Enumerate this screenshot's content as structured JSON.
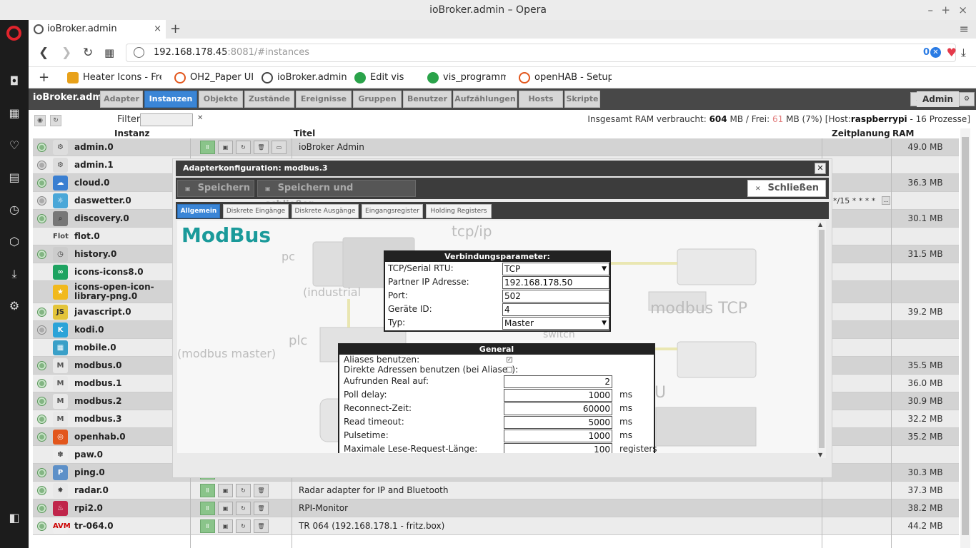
{
  "window": {
    "title": "ioBroker.admin – Opera",
    "minimize": "–",
    "maximize": "+",
    "close": "×"
  },
  "browser": {
    "tab_title": "ioBroker.admin",
    "tab_close": "×",
    "new_tab": "+",
    "tab_menu": "≡",
    "url_host": "192.168.178.45",
    "url_rest": ":8081/#instances",
    "blocker_count": "0",
    "bookmarks": [
      "Heater Icons - Free",
      "OH2_Paper UI",
      "ioBroker.admin",
      "Edit vis",
      "vis_programmierun",
      "openHAB - Setup"
    ],
    "bookmark_add": "+"
  },
  "app": {
    "brand": "ioBroker.admin",
    "nav_tabs": [
      "Adapter",
      "Instanzen",
      "Objekte",
      "Zustände",
      "Ereignisse",
      "Gruppen",
      "Benutzer",
      "Aufzählungen",
      "Hosts",
      "Skripte"
    ],
    "active_tab": "Instanzen",
    "user": "Admin",
    "filter_label": "Filter:",
    "filter_value": "",
    "ram": {
      "prefix": "Insgesamt RAM verbraucht:",
      "used": "604",
      "mid": "MB / Frei:",
      "free": "61",
      "pct": "MB (7%)",
      "host_pre": "[Host:",
      "host": "raspberrypi",
      "host_post": "- 16 Prozesse]"
    },
    "columns": {
      "instanz": "Instanz",
      "titel": "Titel",
      "zeitplanung": "Zeitplanung",
      "ram": "RAM Benutzung"
    },
    "instances": [
      {
        "name": "admin.0",
        "icon": "⚙",
        "running": true,
        "title": "ioBroker Admin",
        "ram": "49.0 MB"
      },
      {
        "name": "admin.1",
        "icon": "⚙",
        "running": false,
        "title": "",
        "ram": ""
      },
      {
        "name": "cloud.0",
        "icon": "☁",
        "running": true,
        "title": "",
        "ram": "36.3 MB"
      },
      {
        "name": "daswetter.0",
        "icon": "☼",
        "running": false,
        "title": "",
        "ram": ""
      },
      {
        "name": "discovery.0",
        "icon": "⌕",
        "running": true,
        "title": "",
        "ram": "30.1 MB"
      },
      {
        "name": "flot.0",
        "icon": "Flot",
        "running": null,
        "title": "",
        "ram": ""
      },
      {
        "name": "history.0",
        "icon": "◷",
        "running": true,
        "title": "",
        "ram": "31.5 MB"
      },
      {
        "name": "icons-icons8.0",
        "icon": "∞",
        "running": null,
        "title": "",
        "ram": ""
      },
      {
        "name": "icons-open-icon-library-png.0",
        "icon": "★",
        "running": null,
        "title": "",
        "ram": ""
      },
      {
        "name": "javascript.0",
        "icon": "JS",
        "running": true,
        "title": "",
        "ram": "39.2 MB"
      },
      {
        "name": "kodi.0",
        "icon": "K",
        "running": false,
        "title": "",
        "ram": ""
      },
      {
        "name": "mobile.0",
        "icon": "▦",
        "running": null,
        "title": "",
        "ram": ""
      },
      {
        "name": "modbus.0",
        "icon": "M",
        "running": true,
        "title": "",
        "ram": "35.5 MB"
      },
      {
        "name": "modbus.1",
        "icon": "M",
        "running": true,
        "title": "",
        "ram": "36.0 MB"
      },
      {
        "name": "modbus.2",
        "icon": "M",
        "running": true,
        "title": "",
        "ram": "30.9 MB"
      },
      {
        "name": "modbus.3",
        "icon": "M",
        "running": true,
        "title": "",
        "ram": "32.2 MB"
      },
      {
        "name": "openhab.0",
        "icon": "◎",
        "running": true,
        "title": "",
        "ram": "35.2 MB"
      },
      {
        "name": "paw.0",
        "icon": "✽",
        "running": null,
        "title": "",
        "ram": ""
      },
      {
        "name": "ping.0",
        "icon": "P",
        "running": true,
        "title": "",
        "ram": "30.3 MB"
      },
      {
        "name": "radar.0",
        "icon": "✸",
        "running": true,
        "title": "Radar adapter for IP and Bluetooth",
        "ram": "37.3 MB"
      },
      {
        "name": "rpi2.0",
        "icon": "♨",
        "running": true,
        "title": "RPI-Monitor",
        "ram": "38.2 MB"
      },
      {
        "name": "tr-064.0",
        "icon": "AVM",
        "running": true,
        "title": "TR 064 (192.168.178.1 - fritz.box)",
        "ram": "44.2 MB"
      }
    ],
    "schedule_text": "*/15 * * * *"
  },
  "dialog": {
    "title": "Adapterkonfiguration: modbus.3",
    "close": "✕",
    "btn_save": "Speichern",
    "btn_save_close": "Speichern und schließen",
    "btn_close": "Schließen",
    "tabs": [
      "Allgemein",
      "Diskrete Eingänge",
      "Diskrete Ausgänge",
      "Eingangsregister",
      "Holding Registers"
    ],
    "active_tab": "Allgemein",
    "heading": "ModBus",
    "bg_labels": [
      "pc",
      "(industrial",
      "tcp/ip",
      "modbus TCP",
      "plc",
      "(modbus master)",
      "switch",
      "U"
    ],
    "conn": {
      "title": "Verbindungsparameter:",
      "fields": [
        {
          "label": "TCP/Serial RTU:",
          "value": "TCP",
          "select": true
        },
        {
          "label": "Partner IP Adresse:",
          "value": "192.168.178.50",
          "select": false
        },
        {
          "label": "Port:",
          "value": "502",
          "select": false
        },
        {
          "label": "Geräte ID:",
          "value": "4",
          "select": false
        },
        {
          "label": "Typ:",
          "value": "Master",
          "select": true
        }
      ]
    },
    "general": {
      "title": "General",
      "checks": [
        {
          "label": "Aliases benutzen:",
          "checked": true
        },
        {
          "label": "Direkte Adressen benutzen (bei Aliases):",
          "checked": false
        }
      ],
      "fields": [
        {
          "label": "Aufrunden Real auf:",
          "value": "2",
          "unit": ""
        },
        {
          "label": "Poll delay:",
          "value": "1000",
          "unit": "ms"
        },
        {
          "label": "Reconnect-Zeit:",
          "value": "60000",
          "unit": "ms"
        },
        {
          "label": "Read timeout:",
          "value": "5000",
          "unit": "ms"
        },
        {
          "label": "Pulsetime:",
          "value": "1000",
          "unit": "ms"
        },
        {
          "label": "Maximale Lese-Request-Länge:",
          "value": "100",
          "unit": "registers"
        }
      ]
    }
  }
}
